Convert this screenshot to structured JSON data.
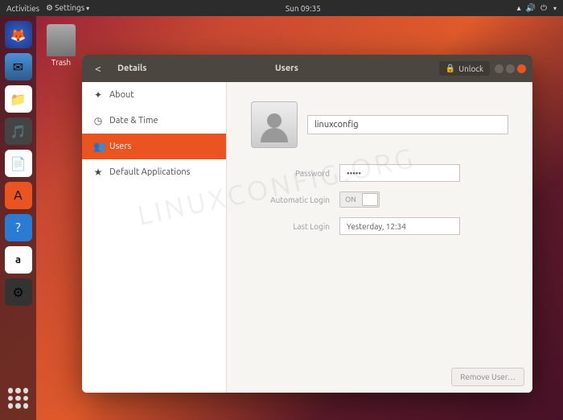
{
  "topbar": {
    "activities": "Activities",
    "app": "Settings",
    "time": "Sun 09:35"
  },
  "trash_label": "Trash",
  "window": {
    "back": "Details",
    "title": "Users",
    "unlock": "Unlock"
  },
  "sidebar": {
    "items": [
      {
        "icon": "✦",
        "label": "About"
      },
      {
        "icon": "◷",
        "label": "Date & Time"
      },
      {
        "icon": "👥",
        "label": "Users"
      },
      {
        "icon": "★",
        "label": "Default Applications"
      }
    ]
  },
  "user": {
    "name": "linuxconfig",
    "password_label": "Password",
    "password_value": "•••••",
    "autologin_label": "Automatic Login",
    "autologin_value": "ON",
    "lastlogin_label": "Last Login",
    "lastlogin_value": "Yesterday, 12:34"
  },
  "footer": {
    "remove_user": "Remove User…"
  },
  "watermark": "LINUXCONFIG.ORG"
}
